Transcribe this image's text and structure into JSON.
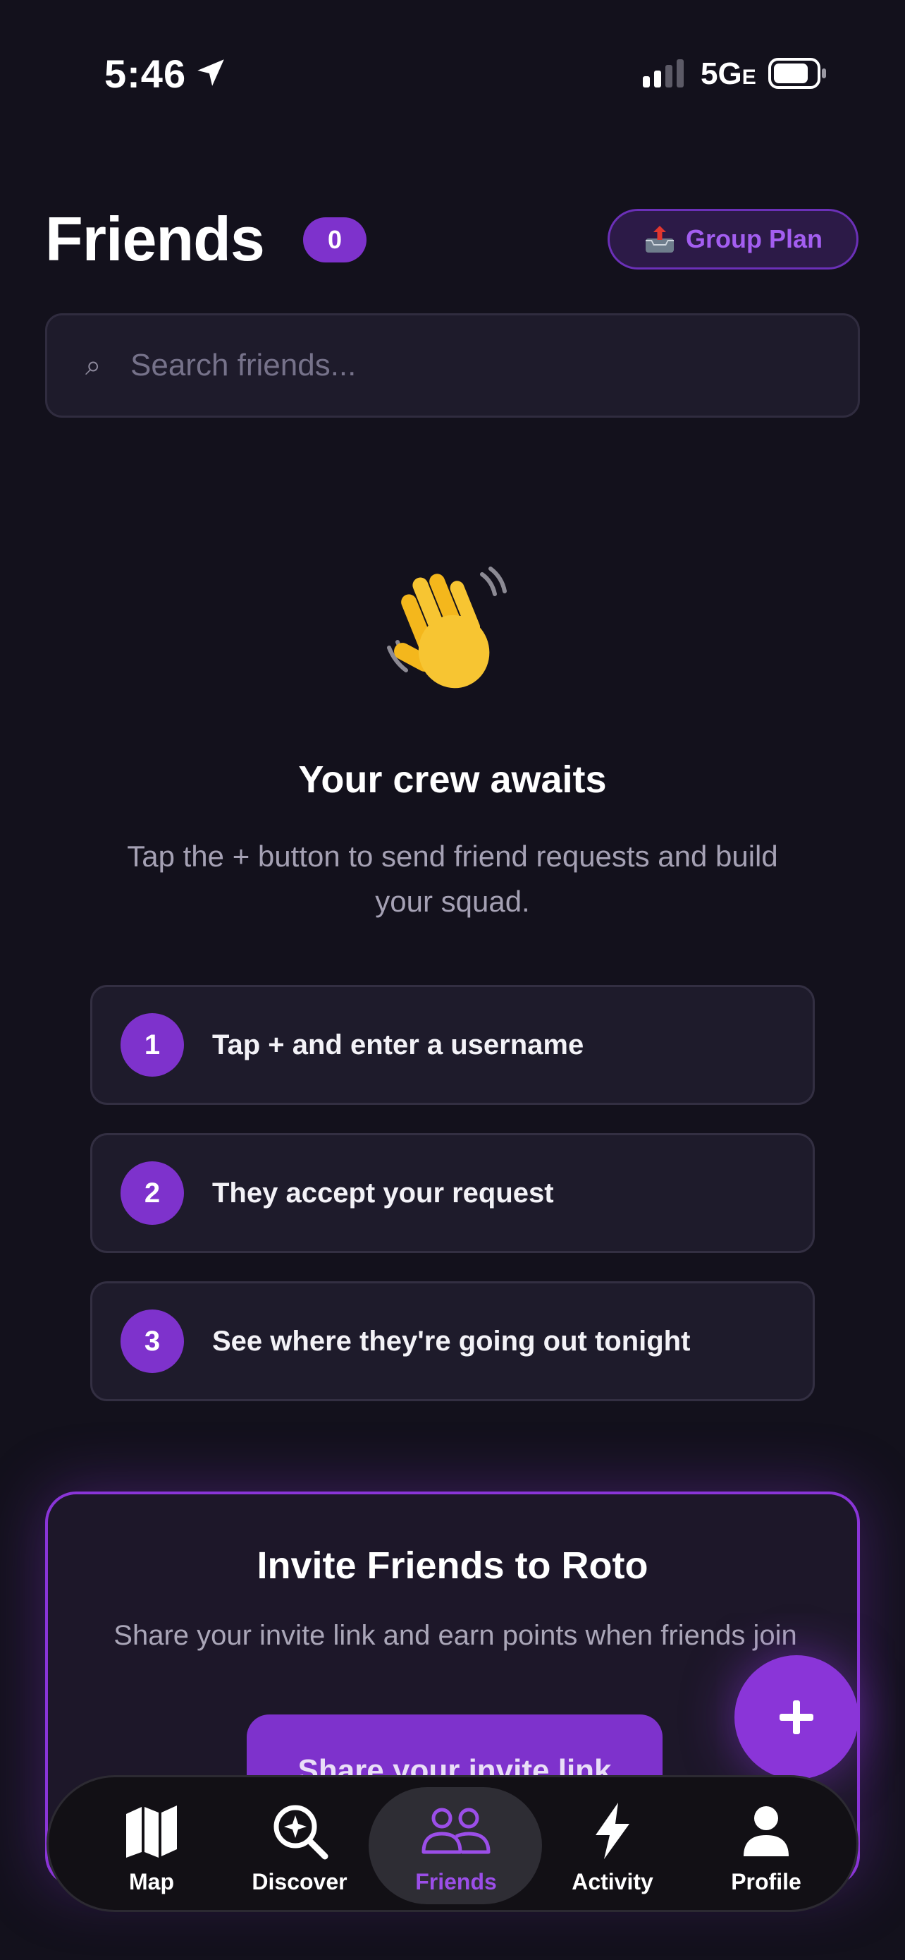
{
  "status_bar": {
    "time": "5:46",
    "network": "5G",
    "network_suffix": "E"
  },
  "header": {
    "title": "Friends",
    "friend_count": "0",
    "group_plan_label": "Group Plan"
  },
  "search": {
    "placeholder": "Search friends..."
  },
  "empty_state": {
    "title": "Your crew awaits",
    "subtitle": "Tap the + button to send friend requests and build your squad."
  },
  "steps": [
    {
      "number": "1",
      "text": "Tap + and enter a username"
    },
    {
      "number": "2",
      "text": "They accept your request"
    },
    {
      "number": "3",
      "text": "See where they're going out tonight"
    }
  ],
  "invite": {
    "title": "Invite Friends to Roto",
    "subtitle": "Share your invite link and earn points when friends join",
    "button_label": "Share your invite link"
  },
  "tabs": [
    {
      "label": "Map",
      "icon": "map-icon"
    },
    {
      "label": "Discover",
      "icon": "discover-icon"
    },
    {
      "label": "Friends",
      "icon": "friends-icon",
      "active": true
    },
    {
      "label": "Activity",
      "icon": "activity-icon"
    },
    {
      "label": "Profile",
      "icon": "profile-icon"
    }
  ],
  "colors": {
    "background": "#13111c",
    "accent": "#7e32cc",
    "accent_text": "#a35ef0"
  }
}
